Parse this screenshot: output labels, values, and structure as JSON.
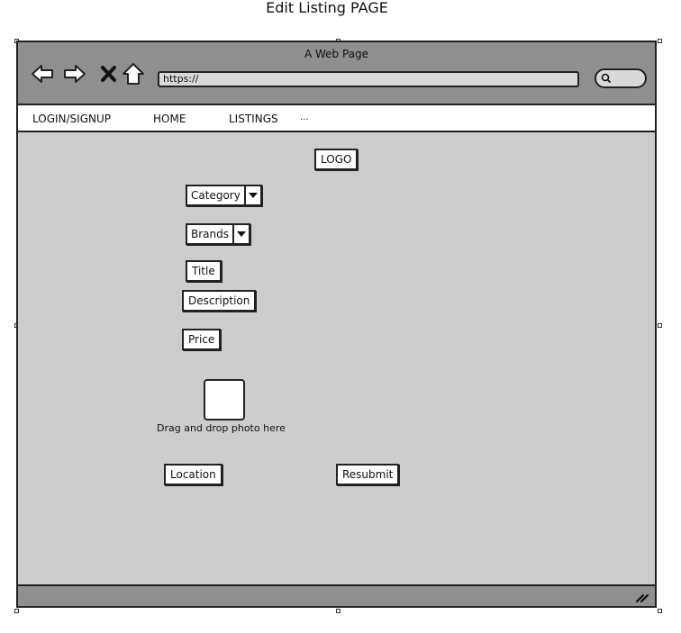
{
  "page_title": "Edit Listing PAGE",
  "browser": {
    "window_title": "A Web Page",
    "url": "https://",
    "icons": [
      "back-arrow-icon",
      "forward-arrow-icon",
      "close-icon",
      "home-icon",
      "search-icon",
      "resize-grip-icon"
    ]
  },
  "menu": {
    "items": [
      {
        "label": "LOGIN/SIGNUP"
      },
      {
        "label": "HOME"
      },
      {
        "label": "LISTINGS"
      },
      {
        "label": "..."
      }
    ]
  },
  "form": {
    "logo": "LOGO",
    "category": "Category",
    "brands": "Brands",
    "title": "Title",
    "description": "Description",
    "price": "Price",
    "photo_hint": "Drag and drop photo here",
    "location": "Location",
    "resubmit": "Resubmit"
  },
  "colors": {
    "frame_background": "#cccccc",
    "chrome": "#8f8f8f",
    "border": "#222222"
  }
}
